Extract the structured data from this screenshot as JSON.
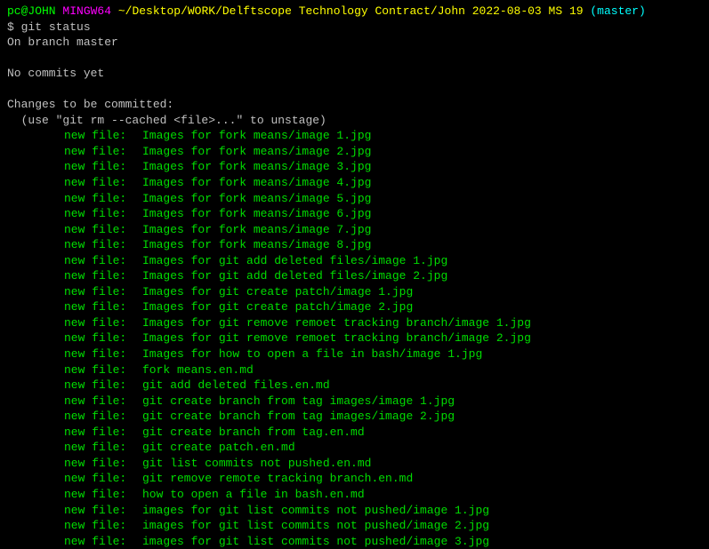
{
  "prompt": {
    "user": "pc@JOHN",
    "env": "MINGW64",
    "tilde": "~",
    "path": "/Desktop/WORK/Delftscope Technology Contract/John 2022-08-03 MS 19",
    "branch_open": "(",
    "branch": "master",
    "branch_close": ")"
  },
  "command": {
    "symbol": "$",
    "text": "git status"
  },
  "status": {
    "on_branch": "On branch master",
    "no_commits": "No commits yet",
    "changes_header": "Changes to be committed:",
    "unstage_hint": "  (use \"git rm --cached <file>...\" to unstage)"
  },
  "files": [
    {
      "status": "new file:",
      "path": "Images for fork means/image 1.jpg"
    },
    {
      "status": "new file:",
      "path": "Images for fork means/image 2.jpg"
    },
    {
      "status": "new file:",
      "path": "Images for fork means/image 3.jpg"
    },
    {
      "status": "new file:",
      "path": "Images for fork means/image 4.jpg"
    },
    {
      "status": "new file:",
      "path": "Images for fork means/image 5.jpg"
    },
    {
      "status": "new file:",
      "path": "Images for fork means/image 6.jpg"
    },
    {
      "status": "new file:",
      "path": "Images for fork means/image 7.jpg"
    },
    {
      "status": "new file:",
      "path": "Images for fork means/image 8.jpg"
    },
    {
      "status": "new file:",
      "path": "Images for git add deleted files/image 1.jpg"
    },
    {
      "status": "new file:",
      "path": "Images for git add deleted files/image 2.jpg"
    },
    {
      "status": "new file:",
      "path": "Images for git create patch/image 1.jpg"
    },
    {
      "status": "new file:",
      "path": "Images for git create patch/image 2.jpg"
    },
    {
      "status": "new file:",
      "path": "Images for git remove remoet tracking branch/image 1.jpg"
    },
    {
      "status": "new file:",
      "path": "Images for git remove remoet tracking branch/image 2.jpg"
    },
    {
      "status": "new file:",
      "path": "Images for how to open a file in bash/image 1.jpg"
    },
    {
      "status": "new file:",
      "path": "fork means.en.md"
    },
    {
      "status": "new file:",
      "path": "git add deleted files.en.md"
    },
    {
      "status": "new file:",
      "path": "git create branch from tag images/image 1.jpg"
    },
    {
      "status": "new file:",
      "path": "git create branch from tag images/image 2.jpg"
    },
    {
      "status": "new file:",
      "path": "git create branch from tag.en.md"
    },
    {
      "status": "new file:",
      "path": "git create patch.en.md"
    },
    {
      "status": "new file:",
      "path": "git list commits not pushed.en.md"
    },
    {
      "status": "new file:",
      "path": "git remove remote tracking branch.en.md"
    },
    {
      "status": "new file:",
      "path": "how to open a file in bash.en.md"
    },
    {
      "status": "new file:",
      "path": "images for git list commits not pushed/image 1.jpg"
    },
    {
      "status": "new file:",
      "path": "images for git list commits not pushed/image 2.jpg"
    },
    {
      "status": "new file:",
      "path": "images for git list commits not pushed/image 3.jpg"
    }
  ]
}
